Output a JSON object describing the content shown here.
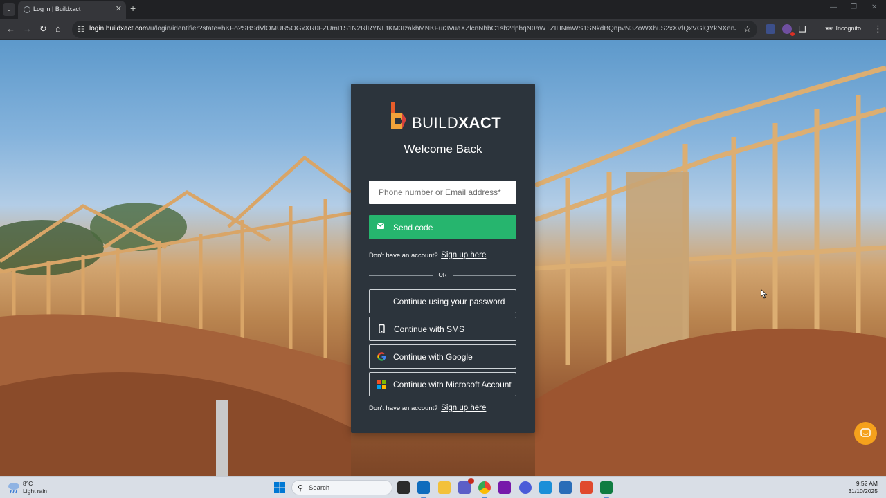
{
  "browser": {
    "tab_title": "Log in | Buildxact",
    "url_domain": "login.buildxact.com",
    "url_path": "/u/login/identifier?state=hKFo2SBSdVlOMUR5OGxXR0FZUmI1S1N2RlRYNEtKM3IzakhMNKFur3VuaXZlcnNhbC1sb2dpbqN0aWTZIHNmWS1SNkdBQnpvN3ZoWXhuS2xXVlQxVGlQYkNXenJlo2NpZNkgemN6d...",
    "incognito_label": "Incognito",
    "colors": {
      "chrome_bg": "#202124",
      "toolbar_bg": "#35363a"
    }
  },
  "login": {
    "brand_prefix": "BUILD",
    "brand_suffix": "XACT",
    "heading": "Welcome Back",
    "email_placeholder": "Phone number or Email address*",
    "send_code_label": "Send code",
    "signup_prompt": "Don't have an account?",
    "signup_link": "Sign up here",
    "divider_text": "OR",
    "alt_options": {
      "password": "Continue using your password",
      "sms": "Continue with SMS",
      "google": "Continue with Google",
      "microsoft": "Continue with Microsoft Account"
    },
    "icons": {
      "send": "envelope-icon",
      "sms": "mobile-phone-icon",
      "google": "google-logo-icon",
      "microsoft": "microsoft-logo-icon",
      "chat": "chat-bubble-icon"
    },
    "colors": {
      "card_bg": "#2c343c",
      "primary_green": "#26b56e",
      "chat_orange": "#f5a11c"
    }
  },
  "taskbar": {
    "weather_temp": "8°C",
    "weather_desc": "Light rain",
    "search_placeholder": "Search",
    "time": "9:52 AM",
    "date": "31/10/2025",
    "teams_badge": "1"
  }
}
